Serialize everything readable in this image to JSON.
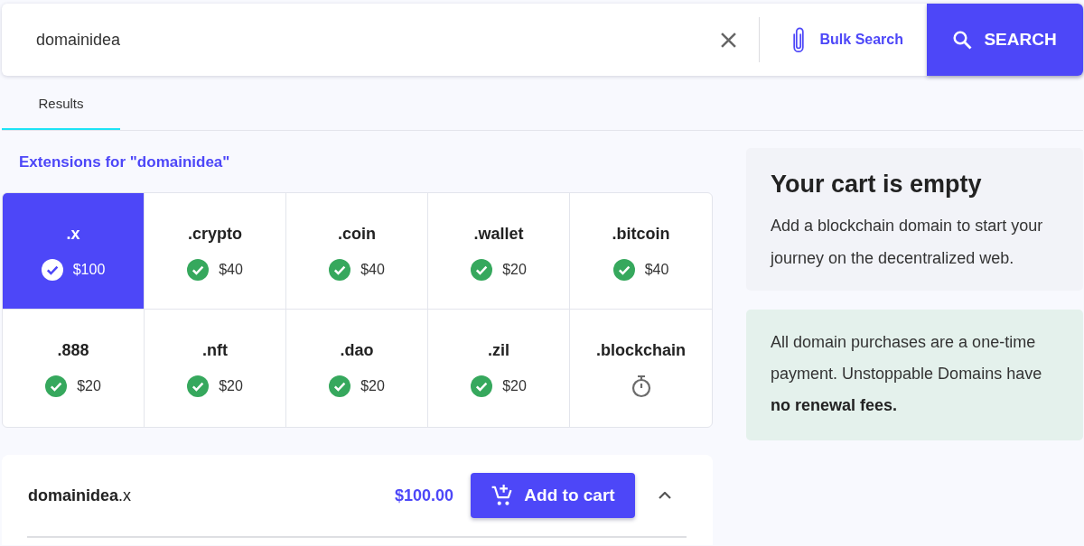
{
  "search": {
    "value": "domainidea",
    "bulk_search": "Bulk Search",
    "button": "SEARCH"
  },
  "tabs": [
    {
      "label": "Results",
      "selected": true
    }
  ],
  "extensions": {
    "heading": "Extensions for \"domainidea\"",
    "items": [
      {
        "name": ".x",
        "price": "$100",
        "kind": "available",
        "selected": true
      },
      {
        "name": ".crypto",
        "price": "$40",
        "kind": "available",
        "selected": false
      },
      {
        "name": ".coin",
        "price": "$40",
        "kind": "available",
        "selected": false
      },
      {
        "name": ".wallet",
        "price": "$20",
        "kind": "available",
        "selected": false
      },
      {
        "name": ".bitcoin",
        "price": "$40",
        "kind": "available",
        "selected": false
      },
      {
        "name": ".888",
        "price": "$20",
        "kind": "available",
        "selected": false
      },
      {
        "name": ".nft",
        "price": "$20",
        "kind": "available",
        "selected": false
      },
      {
        "name": ".dao",
        "price": "$20",
        "kind": "available",
        "selected": false
      },
      {
        "name": ".zil",
        "price": "$20",
        "kind": "available",
        "selected": false
      },
      {
        "name": ".blockchain",
        "kind": "pending",
        "selected": false
      }
    ]
  },
  "result": {
    "domain": "**domainidea**.x",
    "price": "$100.00",
    "button": "Add to cart",
    "expanded": true
  },
  "cart": {
    "title": "Your cart is empty",
    "text": "Add a blockchain domain to start your journey on the decentralized web."
  },
  "notice": {
    "text": "All domain purchases are a one-time payment. Unstoppable Domains have **no renewal fees.**"
  }
}
